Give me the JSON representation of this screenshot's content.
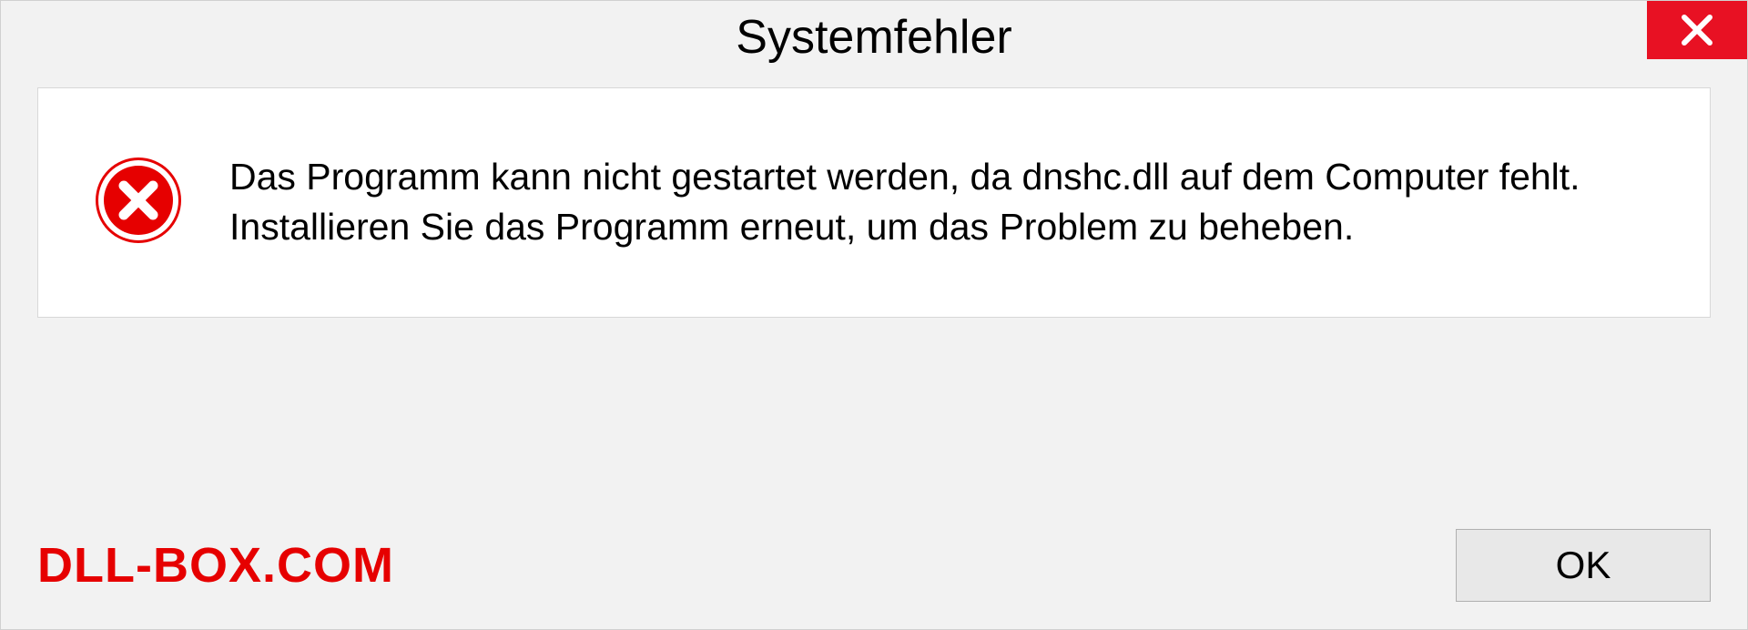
{
  "dialog": {
    "title": "Systemfehler",
    "message": "Das Programm kann nicht gestartet werden, da dnshc.dll auf dem Computer fehlt. Installieren Sie das Programm erneut, um das Problem zu beheben.",
    "ok_label": "OK"
  },
  "watermark": "DLL-BOX.COM"
}
